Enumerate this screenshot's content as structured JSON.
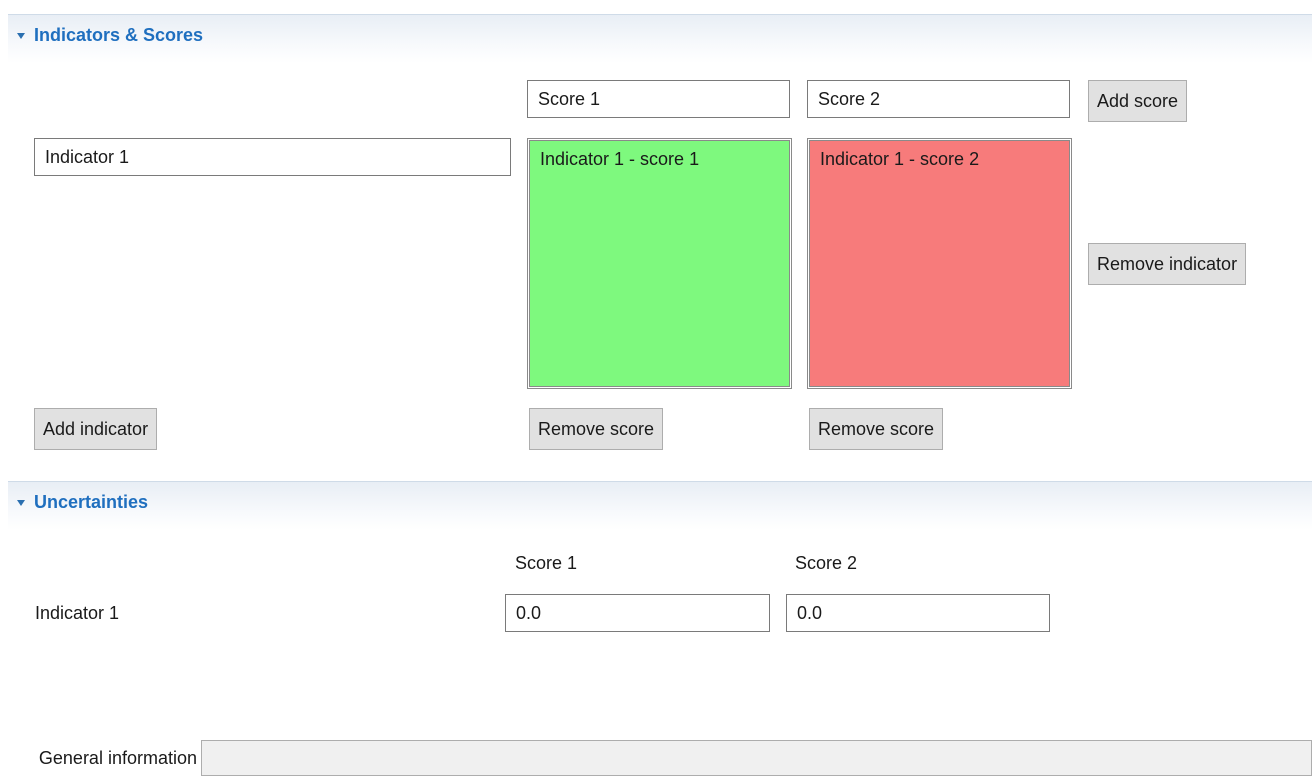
{
  "indicators_section": {
    "title": "Indicators & Scores",
    "score_fields": [
      "Score 1",
      "Score 2"
    ],
    "add_score_label": "Add score",
    "indicator_field": "Indicator 1",
    "cells": [
      {
        "text": "Indicator 1 - score 1",
        "color": "#7ef97e"
      },
      {
        "text": "Indicator 1 - score 2",
        "color": "#f77b7b"
      }
    ],
    "remove_indicator_label": "Remove indicator",
    "add_indicator_label": "Add indicator",
    "remove_score_labels": [
      "Remove score",
      "Remove score"
    ]
  },
  "uncertainties_section": {
    "title": "Uncertainties",
    "score_headers": [
      "Score 1",
      "Score 2"
    ],
    "indicator_label": "Indicator 1",
    "values": [
      "0.0",
      "0.0"
    ]
  },
  "general_information": {
    "label": "General information",
    "value": ""
  },
  "colors": {
    "header_title": "#1f6fbf",
    "positive_cell": "#7ef97e",
    "negative_cell": "#f77b7b",
    "button_bg": "#e1e1e1"
  }
}
